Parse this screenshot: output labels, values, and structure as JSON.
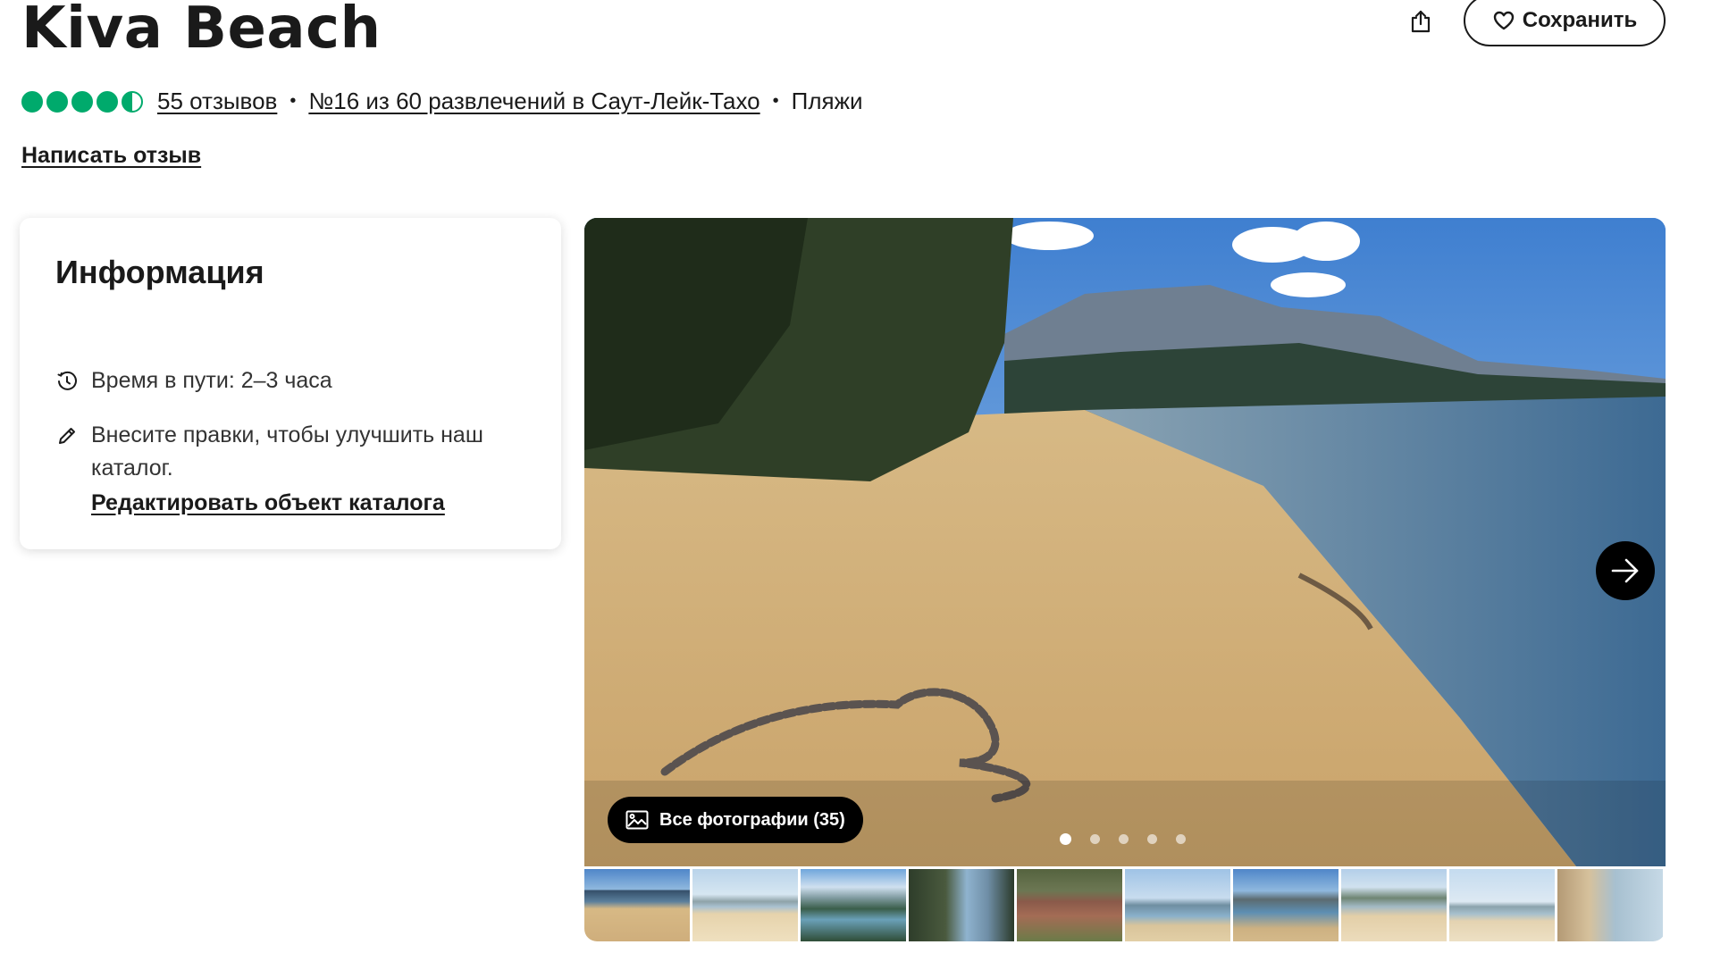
{
  "header": {
    "title": "Kiva Beach",
    "save_label": "Сохранить",
    "icons": {
      "share": "share-icon",
      "save": "heart-icon"
    }
  },
  "rating": {
    "value": 4.5,
    "max": 5,
    "reviews_label": "55 отзывов",
    "rank_label": "№16 из 60 развлечений в Саут-Лейк-Тахо",
    "category": "Пляжи",
    "separator": "•"
  },
  "write_review_label": "Написать отзыв",
  "info": {
    "title": "Информация",
    "duration_label": "Время в пути: 2–3 часа",
    "improve_text": "Внесите правки, чтобы улучшить наш каталог.",
    "edit_link": "Редактировать объект каталога",
    "icons": {
      "duration": "clock-icon",
      "edit": "pencil-icon"
    }
  },
  "gallery": {
    "all_photos_label": "Все фотографии (35)",
    "dots_count": 5,
    "active_dot": 0,
    "thumbnail_count": 10,
    "icons": {
      "all_photos": "image-icon",
      "next": "arrow-right-icon"
    }
  },
  "colors": {
    "rating_green": "#00aa6c",
    "text": "#1a1a1a"
  }
}
